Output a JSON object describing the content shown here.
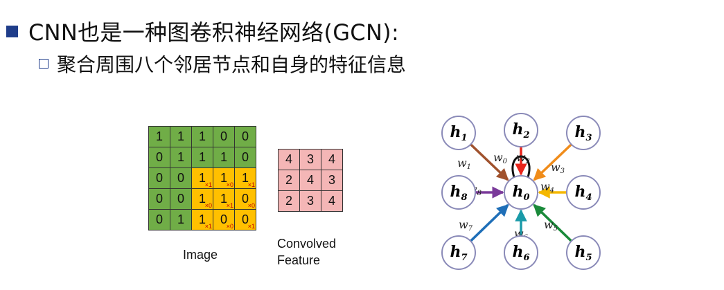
{
  "bullets": {
    "main": "CNN也是一种图卷积神经网络(GCN):",
    "sub": "聚合周围八个邻居节点和自身的特征信息"
  },
  "image_grid": {
    "caption": "Image",
    "rows": [
      [
        {
          "v": "1",
          "c": "g"
        },
        {
          "v": "1",
          "c": "g"
        },
        {
          "v": "1",
          "c": "g"
        },
        {
          "v": "0",
          "c": "g"
        },
        {
          "v": "0",
          "c": "g"
        }
      ],
      [
        {
          "v": "0",
          "c": "g"
        },
        {
          "v": "1",
          "c": "g"
        },
        {
          "v": "1",
          "c": "g"
        },
        {
          "v": "1",
          "c": "g"
        },
        {
          "v": "0",
          "c": "g"
        }
      ],
      [
        {
          "v": "0",
          "c": "g"
        },
        {
          "v": "0",
          "c": "g"
        },
        {
          "v": "1",
          "c": "o",
          "w": "×1"
        },
        {
          "v": "1",
          "c": "o",
          "w": "×0"
        },
        {
          "v": "1",
          "c": "o",
          "w": "×1"
        }
      ],
      [
        {
          "v": "0",
          "c": "g"
        },
        {
          "v": "0",
          "c": "g"
        },
        {
          "v": "1",
          "c": "o",
          "w": "×0"
        },
        {
          "v": "1",
          "c": "o",
          "w": "×1"
        },
        {
          "v": "0",
          "c": "o",
          "w": "×0"
        }
      ],
      [
        {
          "v": "0",
          "c": "g"
        },
        {
          "v": "1",
          "c": "g"
        },
        {
          "v": "1",
          "c": "o",
          "w": "×1"
        },
        {
          "v": "0",
          "c": "o",
          "w": "×0"
        },
        {
          "v": "0",
          "c": "o",
          "w": "×1"
        }
      ]
    ]
  },
  "conv_grid": {
    "caption_line1": "Convolved",
    "caption_line2": "Feature",
    "rows": [
      [
        "4",
        "3",
        "4"
      ],
      [
        "2",
        "4",
        "3"
      ],
      [
        "2",
        "3",
        "4"
      ]
    ]
  },
  "graph": {
    "center": {
      "base": "h",
      "sub": "0"
    },
    "neighbors": [
      {
        "id": "h1",
        "sub": "1",
        "weight": "1",
        "color": "#a0522d"
      },
      {
        "id": "h2",
        "sub": "2",
        "weight": "2",
        "color": "#e8251c"
      },
      {
        "id": "h3",
        "sub": "3",
        "weight": "3",
        "color": "#f08c1a"
      },
      {
        "id": "h4",
        "sub": "4",
        "weight": "4",
        "color": "#f5b800"
      },
      {
        "id": "h5",
        "sub": "5",
        "weight": "5",
        "color": "#1a8a3a"
      },
      {
        "id": "h6",
        "sub": "6",
        "weight": "6",
        "color": "#1a9aa8"
      },
      {
        "id": "h7",
        "sub": "7",
        "weight": "7",
        "color": "#1f6fb8"
      },
      {
        "id": "h8",
        "sub": "8",
        "weight": "8",
        "color": "#7a3a9a"
      }
    ],
    "self_weight": "0",
    "node_fill": "#ffffff",
    "node_stroke": "#8a8ab8"
  }
}
